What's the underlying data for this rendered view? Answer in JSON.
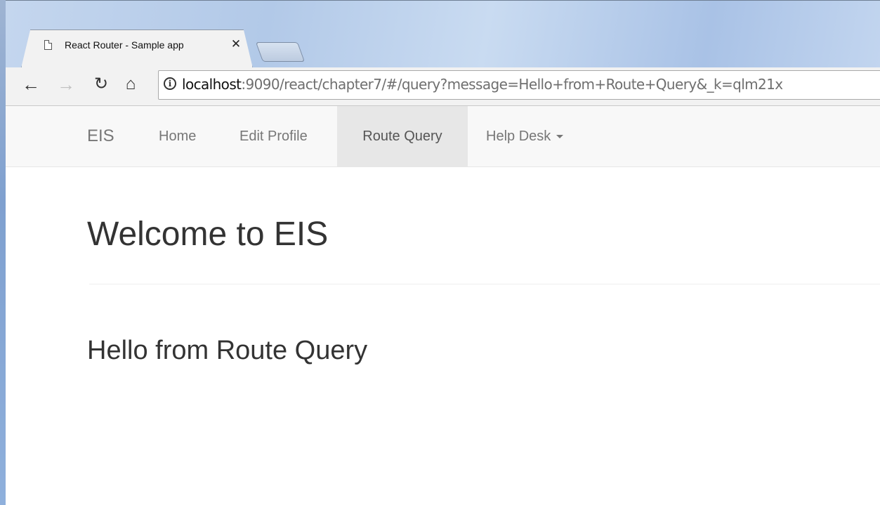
{
  "browser": {
    "tab": {
      "title": "React Router - Sample app",
      "page_icon": "page-icon",
      "close_icon": "close-icon"
    },
    "toolbar": {
      "back_icon": "back-arrow-icon",
      "forward_icon": "forward-arrow-icon",
      "reload_icon": "reload-icon",
      "home_icon": "home-icon",
      "info_icon": "info-icon"
    },
    "address": {
      "host": "localhost",
      "rest": ":9090/react/chapter7/#/query?message=Hello+from+Route+Query&_k=qlm21x"
    }
  },
  "navbar": {
    "brand": "EIS",
    "items": [
      {
        "label": "Home",
        "active": false
      },
      {
        "label": "Edit Profile",
        "active": false
      },
      {
        "label": "Route Query",
        "active": true
      },
      {
        "label": "Help Desk",
        "active": false,
        "dropdown": true
      }
    ]
  },
  "main": {
    "heading": "Welcome to EIS",
    "message": "Hello from Route Query"
  },
  "colors": {
    "navbar_bg": "#f8f8f8",
    "active_item_bg": "#e7e7e7",
    "nav_text": "#777777",
    "body_text": "#333333"
  }
}
